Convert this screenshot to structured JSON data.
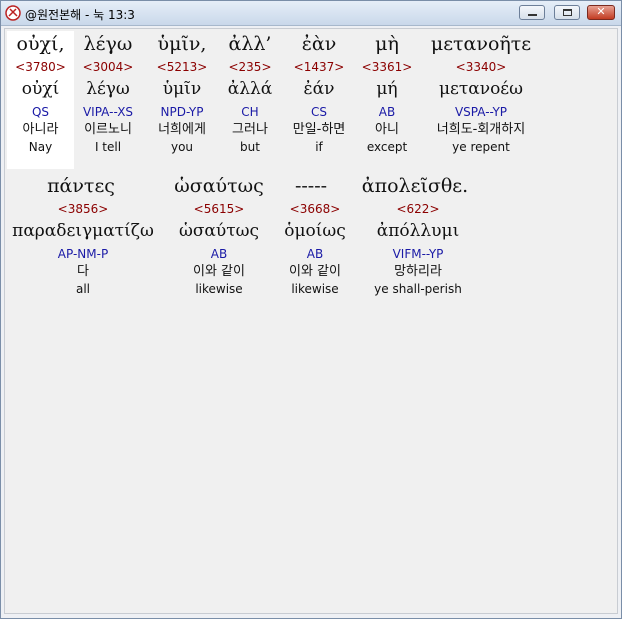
{
  "window": {
    "title": "@원전본해 - 눅 13:3",
    "min_glyph": "",
    "max_glyph": "",
    "close_glyph": "✕"
  },
  "verse": {
    "row1": [
      {
        "greek": "οὐχί,",
        "strong": "<3780>",
        "lemma": "οὐχί",
        "parse": "QS",
        "korean": "아니라",
        "english": "Nay"
      },
      {
        "greek": "λέγω",
        "strong": "<3004>",
        "lemma": "λέγω",
        "parse": "VIPA--XS",
        "korean": "이르노니",
        "english": "I tell"
      },
      {
        "greek": "ὑμῖν,",
        "strong": "<5213>",
        "lemma": "ὑμῖν",
        "parse": "NPD-YP",
        "korean": "너희에게",
        "english": "you"
      },
      {
        "greek": "ἀλλ’",
        "strong": "<235>",
        "lemma": "ἀλλά",
        "parse": "CH",
        "korean": "그러나",
        "english": "but"
      },
      {
        "greek": "ἐὰν",
        "strong": "<1437>",
        "lemma": "ἐάν",
        "parse": "CS",
        "korean": "만일-하면",
        "english": "if"
      },
      {
        "greek": "μὴ",
        "strong": "<3361>",
        "lemma": "μή",
        "parse": "AB",
        "korean": "아니",
        "english": "except"
      },
      {
        "greek": "μετανοῆτε",
        "strong": "<3340>",
        "lemma": "μετανοέω",
        "parse": "VSPA--YP",
        "korean": "너희도-회개하지",
        "english": "ye repent"
      }
    ],
    "row2_greek": [
      "πάντες",
      "ὡσαύτως",
      "-----",
      "ἀπολεῖσθε."
    ],
    "row2": [
      {
        "strong": "<3856>",
        "lemma": "παραδειγματίζω",
        "parse": "AP-NM-P",
        "korean": "다",
        "english": "all"
      },
      {
        "strong": "<5615>",
        "lemma": "ὡσαύτως",
        "parse": "AB",
        "korean": "이와 같이",
        "english": "likewise"
      },
      {
        "strong": "<3668>",
        "lemma": "ὁμοίως",
        "parse": "AB",
        "korean": "이와 같이",
        "english": "likewise"
      },
      {
        "strong": "<622>",
        "lemma": "ἀπόλλυμι",
        "parse": "VIFM--YP",
        "korean": "망하리라",
        "english": "ye shall-perish"
      }
    ]
  },
  "colors": {
    "strong": "#8b0000",
    "parse": "#1a1aa6",
    "title_bar": "#c9d8ea",
    "close": "#c23b22"
  }
}
